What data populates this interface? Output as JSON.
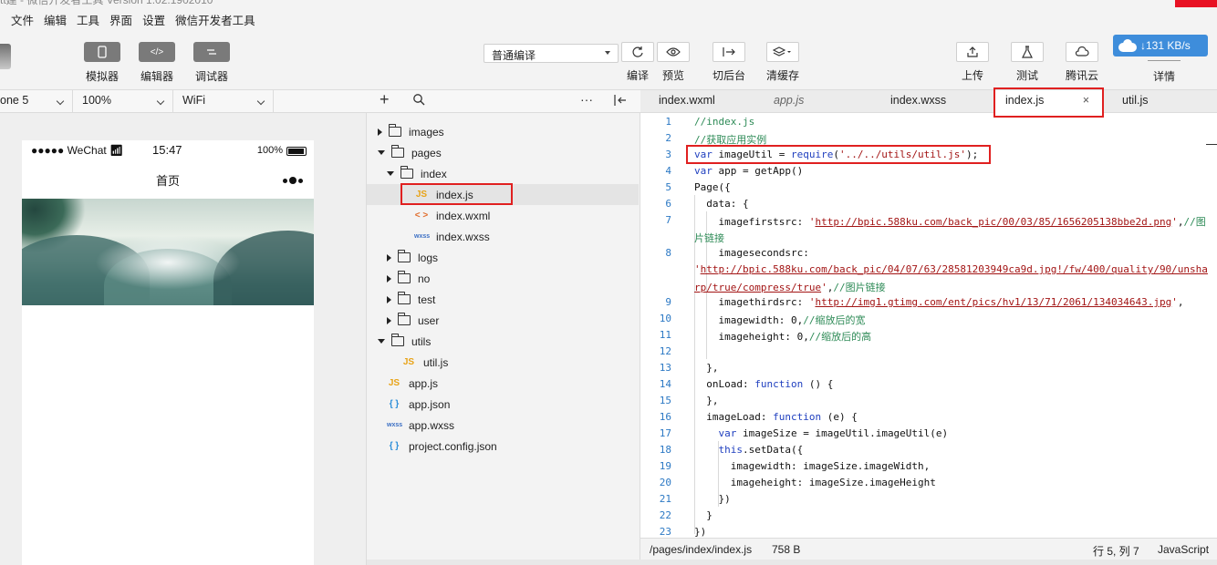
{
  "window": {
    "title": "tt建 - 微信开发者工具 Version 1.02.1902010",
    "title_cutoff": true
  },
  "menu": [
    "文件",
    "编辑",
    "工具",
    "界面",
    "设置",
    "微信开发者工具"
  ],
  "toolbar": {
    "simulator_label": "模拟器",
    "editor_label": "编辑器",
    "debugger_label": "调试器",
    "compile_mode": "普通编译",
    "compile_label": "编译",
    "preview_label": "预览",
    "backend_label": "切后台",
    "clear_cache_label": "清缓存",
    "upload_label": "上传",
    "test_label": "测试",
    "tencent_cloud_label": "腾讯云",
    "details_label": "详情",
    "network_speed": "131 KB/s"
  },
  "device_bar": {
    "device": "one 5",
    "zoom": "100%",
    "network": "WiFi"
  },
  "phone": {
    "carrier": "●●●●● WeChat",
    "time": "15:47",
    "battery": "100%",
    "nav_title": "首页"
  },
  "file_tree": [
    {
      "name": "images",
      "type": "folder",
      "expanded": false,
      "depth": 0
    },
    {
      "name": "pages",
      "type": "folder",
      "expanded": true,
      "depth": 0
    },
    {
      "name": "index",
      "type": "folder",
      "expanded": true,
      "depth": 1
    },
    {
      "name": "index.js",
      "type": "js",
      "depth": 2,
      "selected": true
    },
    {
      "name": "index.wxml",
      "type": "wxml",
      "depth": 2
    },
    {
      "name": "index.wxss",
      "type": "wxss",
      "depth": 2
    },
    {
      "name": "logs",
      "type": "folder",
      "expanded": false,
      "depth": 1
    },
    {
      "name": "no",
      "type": "folder",
      "expanded": false,
      "depth": 1
    },
    {
      "name": "test",
      "type": "folder",
      "expanded": false,
      "depth": 1
    },
    {
      "name": "user",
      "type": "folder",
      "expanded": false,
      "depth": 1
    },
    {
      "name": "utils",
      "type": "folder",
      "expanded": true,
      "depth": 0
    },
    {
      "name": "util.js",
      "type": "js",
      "depth": 1
    },
    {
      "name": "app.js",
      "type": "js",
      "depth": 0
    },
    {
      "name": "app.json",
      "type": "json",
      "depth": 0
    },
    {
      "name": "app.wxss",
      "type": "wxss",
      "depth": 0
    },
    {
      "name": "project.config.json",
      "type": "json",
      "depth": 0
    }
  ],
  "tabs": [
    {
      "name": "index.wxml",
      "active": false,
      "italic": false
    },
    {
      "name": "app.js",
      "active": false,
      "italic": true
    },
    {
      "name": "index.wxss",
      "active": false,
      "italic": false
    },
    {
      "name": "index.js",
      "active": true,
      "italic": false
    },
    {
      "name": "util.js",
      "active": false,
      "italic": false
    }
  ],
  "code_lines": [
    {
      "n": "1",
      "html": "<span class=\"cm\">//index.js</span>"
    },
    {
      "n": "2",
      "html": "<span class=\"cm\">//获取应用实例</span>"
    },
    {
      "n": "3",
      "html": "<span class=\"kw\">var</span> imageUtil = <span class=\"kw\">require</span>(<span class=\"str\">'../../utils/util.js'</span>);"
    },
    {
      "n": "4",
      "html": "<span class=\"kw\">var</span> app = getApp()"
    },
    {
      "n": "5",
      "html": "Page({"
    },
    {
      "n": "6",
      "html": "  data: {"
    },
    {
      "n": "7",
      "html": "    imagefirstsrc: <span class=\"str\">'</span><span class=\"url\">http://bpic.588ku.com/back_pic/00/03/85/1656205138bbe2d.png</span><span class=\"str\">'</span>,<span class=\"cm\">//图</span>"
    },
    {
      "n": "",
      "html": "<span class=\"cm\">片链接</span>"
    },
    {
      "n": "8",
      "html": "    imagesecondsrc:"
    },
    {
      "n": "",
      "html": "<span class=\"str\">'</span><span class=\"url\">http://bpic.588ku.com/back_pic/04/07/63/28581203949ca9d.jpg!/fw/400/quality/90/unsha</span>"
    },
    {
      "n": "",
      "html": "<span class=\"url\">rp/true/compress/true</span><span class=\"str\">'</span>,<span class=\"cm\">//图片链接</span>"
    },
    {
      "n": "9",
      "html": "    imagethirdsrc: <span class=\"str\">'</span><span class=\"url\">http://img1.gtimg.com/ent/pics/hv1/13/71/2061/134034643.jpg</span><span class=\"str\">'</span>,"
    },
    {
      "n": "10",
      "html": "    imagewidth: 0,<span class=\"cm\">//缩放后的宽</span>"
    },
    {
      "n": "11",
      "html": "    imageheight: 0,<span class=\"cm\">//缩放后的高</span>"
    },
    {
      "n": "12",
      "html": ""
    },
    {
      "n": "13",
      "html": "  },"
    },
    {
      "n": "14",
      "html": "  onLoad: <span class=\"kw\">function</span> () {"
    },
    {
      "n": "15",
      "html": "  },"
    },
    {
      "n": "16",
      "html": "  imageLoad: <span class=\"kw\">function</span> (e) {"
    },
    {
      "n": "17",
      "html": "    <span class=\"kw\">var</span> imageSize = imageUtil.imageUtil(e)"
    },
    {
      "n": "18",
      "html": "    <span class=\"kw\">this</span>.setData({"
    },
    {
      "n": "19",
      "html": "      imagewidth: imageSize.imageWidth,"
    },
    {
      "n": "20",
      "html": "      imageheight: imageSize.imageHeight"
    },
    {
      "n": "21",
      "html": "    })"
    },
    {
      "n": "22",
      "html": "  }"
    },
    {
      "n": "23",
      "html": "})"
    }
  ],
  "statusbar": {
    "path": "/pages/index/index.js",
    "size": "758 B",
    "cursor": "行 5, 列 7",
    "language": "JavaScript"
  },
  "colors": {
    "accent_blue": "#3e8ddb",
    "annotation_red": "#e02020",
    "keyword": "#1f3fbf",
    "comment": "#2e8b57",
    "string": "#a31515"
  }
}
